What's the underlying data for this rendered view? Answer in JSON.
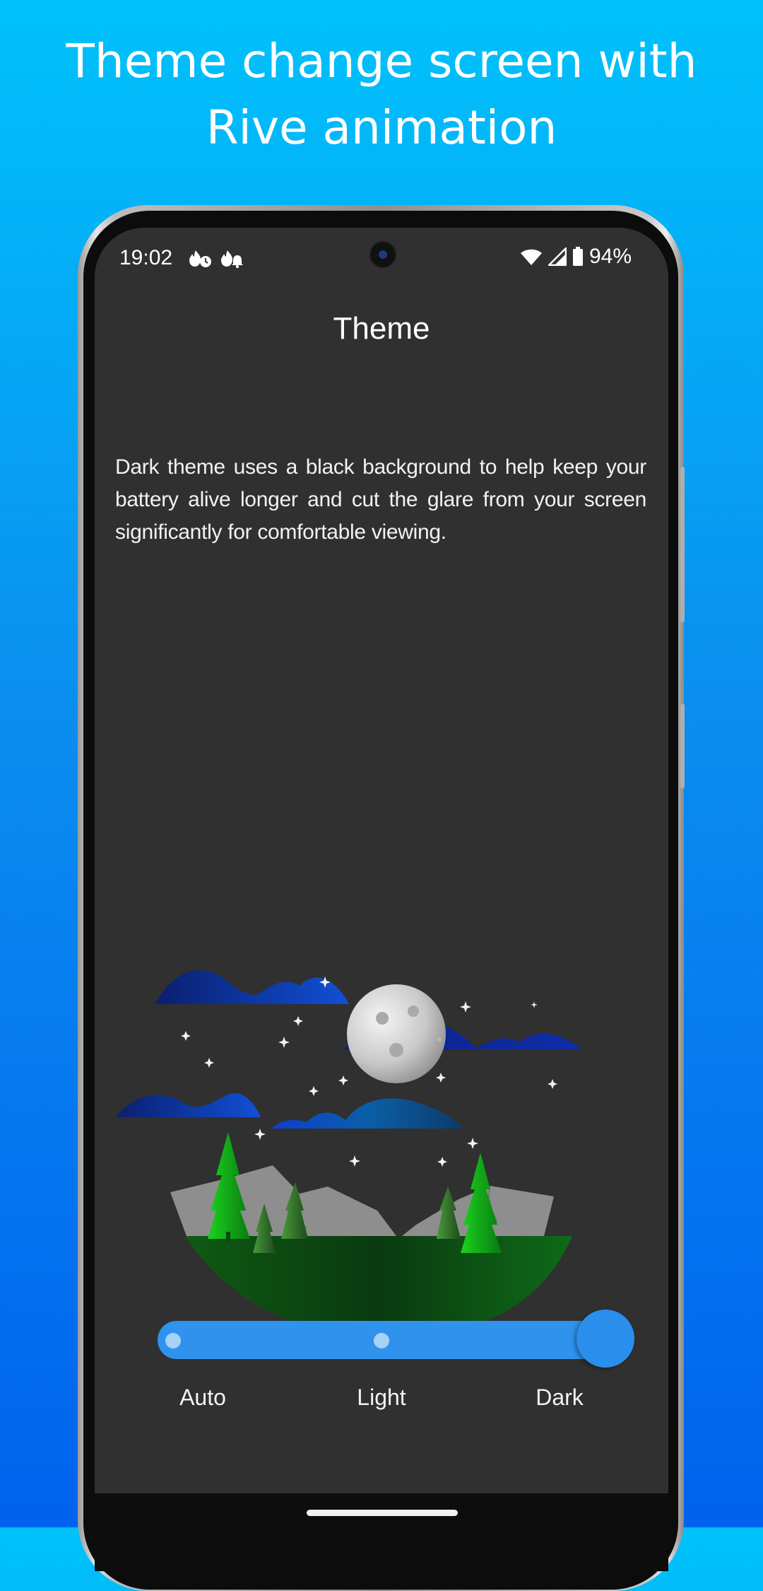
{
  "promo": {
    "title_line1": "Theme change screen with",
    "title_line2": "Rive animation"
  },
  "status_bar": {
    "time": "19:02",
    "notification_icons": [
      "fire-timer-icon",
      "fire-bell-icon"
    ],
    "wifi_icon": "wifi-icon",
    "signal_icon": "cell-signal-icon",
    "battery_icon": "battery-icon",
    "battery_percent": "94%"
  },
  "screen": {
    "title": "Theme",
    "description": "Dark theme uses a black background to help keep your battery alive longer and cut the glare from your screen significantly for comfortable viewing."
  },
  "theme_selector": {
    "options": [
      "Auto",
      "Light",
      "Dark"
    ],
    "selected": "Dark",
    "track_color": "#2f93ee",
    "thumb_color": "#2a8eec"
  },
  "colors": {
    "screen_background": "#303030",
    "accent": "#2a8eec",
    "gradient_top": "#00c2fb",
    "gradient_bottom": "#0062ee"
  }
}
